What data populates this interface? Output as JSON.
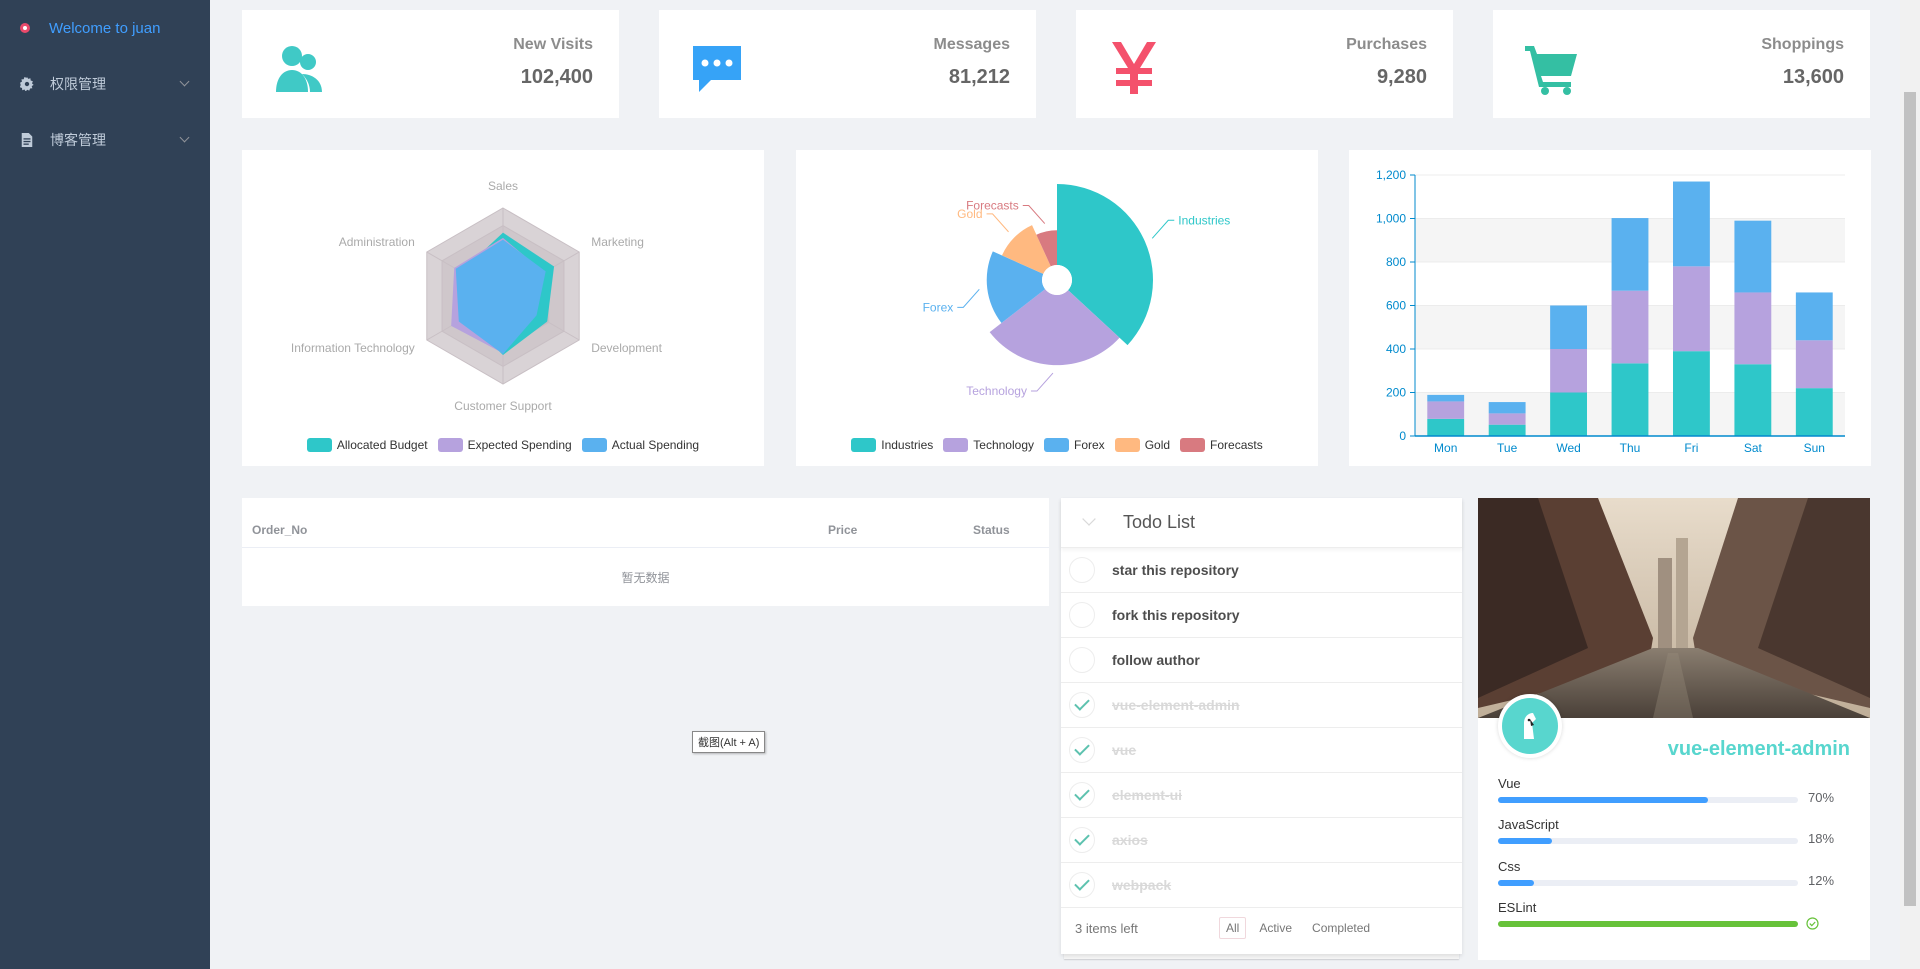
{
  "sidebar": {
    "welcome": "Welcome to juan",
    "items": [
      {
        "label": "权限管理",
        "icon": "gear-icon"
      },
      {
        "label": "博客管理",
        "icon": "document-icon"
      }
    ]
  },
  "panels": [
    {
      "label": "New Visits",
      "value": "102,400",
      "icon": "people-icon",
      "color": "#40c9c6"
    },
    {
      "label": "Messages",
      "value": "81,212",
      "icon": "message-icon",
      "color": "#36a3f7"
    },
    {
      "label": "Purchases",
      "value": "9,280",
      "icon": "money-icon",
      "color": "#f4516c"
    },
    {
      "label": "Shoppings",
      "value": "13,600",
      "icon": "shopping-cart-icon",
      "color": "#34bfa3"
    }
  ],
  "chart_data": [
    {
      "type": "radar",
      "indicators": [
        "Sales",
        "Marketing",
        "Development",
        "Customer Support",
        "Information Technology",
        "Administration"
      ],
      "legend": [
        "Allocated Budget",
        "Expected Spending",
        "Actual Spending"
      ],
      "legend_position": "bottom",
      "colors": [
        "#2ec7c9",
        "#b6a2de",
        "#5ab1ef"
      ],
      "series": [
        {
          "name": "Allocated Budget",
          "values": [
            0.72,
            0.67,
            0.58,
            0.67,
            0.5,
            0.55
          ]
        },
        {
          "name": "Expected Spending",
          "values": [
            0.66,
            0.54,
            0.43,
            0.65,
            0.68,
            0.64
          ]
        },
        {
          "name": "Actual Spending",
          "values": [
            0.64,
            0.56,
            0.44,
            0.66,
            0.58,
            0.62
          ]
        }
      ]
    },
    {
      "type": "pie",
      "subtype": "rose",
      "legend_position": "bottom",
      "categories": [
        "Industries",
        "Technology",
        "Forex",
        "Gold",
        "Forecasts"
      ],
      "values": [
        320,
        240,
        149,
        100,
        59
      ],
      "colors": [
        "#2ec7c9",
        "#b6a2de",
        "#5ab1ef",
        "#ffb980",
        "#d87a80"
      ]
    },
    {
      "type": "bar",
      "stacked": true,
      "categories": [
        "Mon",
        "Tue",
        "Wed",
        "Thu",
        "Fri",
        "Sat",
        "Sun"
      ],
      "ylim": [
        0,
        1200
      ],
      "yticks": [
        "0",
        "200",
        "400",
        "600",
        "800",
        "1,000",
        "1,200"
      ],
      "colors": [
        "#2ec7c9",
        "#b6a2de",
        "#5ab1ef"
      ],
      "series": [
        {
          "values": [
            79,
            52,
            200,
            334,
            390,
            330,
            220
          ]
        },
        {
          "values": [
            80,
            52,
            200,
            334,
            390,
            330,
            220
          ]
        },
        {
          "values": [
            30,
            52,
            200,
            334,
            390,
            330,
            220
          ]
        }
      ]
    }
  ],
  "table": {
    "columns": [
      "Order_No",
      "Price",
      "Status"
    ],
    "empty_text": "暂无数据"
  },
  "todo": {
    "title": "Todo List",
    "items": [
      {
        "text": "star this repository",
        "done": false
      },
      {
        "text": "fork this repository",
        "done": false
      },
      {
        "text": "follow author",
        "done": false
      },
      {
        "text": "vue-element-admin",
        "done": true
      },
      {
        "text": "vue",
        "done": true
      },
      {
        "text": "element-ui",
        "done": true
      },
      {
        "text": "axios",
        "done": true
      },
      {
        "text": "webpack",
        "done": true
      }
    ],
    "left_label": "3 items left",
    "filters": [
      "All",
      "Active",
      "Completed"
    ],
    "selected_filter": "All"
  },
  "box": {
    "title": "vue-element-admin",
    "skills": [
      {
        "label": "Vue",
        "percent": 70,
        "text": "70%",
        "color": "#409eff"
      },
      {
        "label": "JavaScript",
        "percent": 18,
        "text": "18%",
        "color": "#409eff"
      },
      {
        "label": "Css",
        "percent": 12,
        "text": "12%",
        "color": "#409eff"
      },
      {
        "label": "ESLint",
        "percent": 100,
        "text": "",
        "color": "#67c23a",
        "success": true
      }
    ]
  },
  "tooltip": "截图(Alt + A)"
}
